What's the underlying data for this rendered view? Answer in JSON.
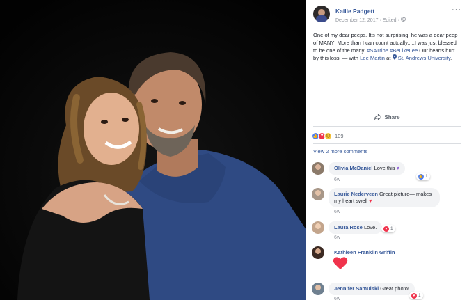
{
  "post": {
    "author": "Kaille Padgett",
    "date": "December 12, 2017",
    "edited": "Edited",
    "text_intro": "One of my dear peeps. It's not surprising, he was a dear peep of MANY! More than I can count actually.....I was just blessed to be one of the many.",
    "hashtags": "#SATribe #BeLikeLee",
    "text_outro": "Our hearts hurt by this loss. —",
    "with_label": "with",
    "tagged_person": "Lee Martin",
    "at_label": "at",
    "location": "St. Andrews University",
    "period": "."
  },
  "actions": {
    "share": "Share",
    "more": "···"
  },
  "reactions": {
    "count": "109"
  },
  "comments_link": "View 2 more comments",
  "comments": [
    {
      "name": "Olivia McDaniel",
      "text": "Love this",
      "time": "6w",
      "badge_count": "1"
    },
    {
      "name": "Laurie Nederveen",
      "text": "Great picture— makes my heart swell",
      "time": "6w"
    },
    {
      "name": "Laura Rose",
      "text": "Love.",
      "time": "6w",
      "badge_count": "1"
    },
    {
      "name": "Kathleen Franklin Griffin",
      "text": "",
      "time": ""
    },
    {
      "name": "Jennifer Samulski",
      "text": "Great photo!",
      "time": "6w",
      "badge_count": "1"
    }
  ],
  "colors": {
    "link": "#365899",
    "bubble": "#f2f3f5",
    "love": "#f0334c",
    "like": "#4f7ff0"
  }
}
